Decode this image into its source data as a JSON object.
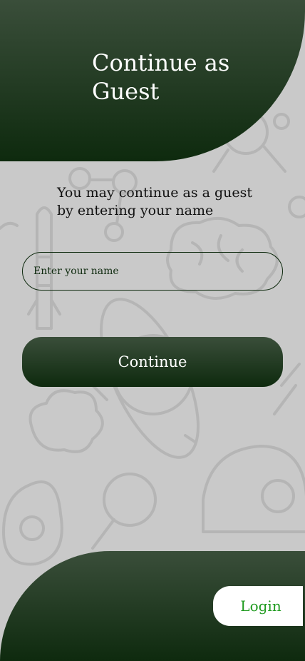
{
  "header": {
    "title": "Continue as Guest"
  },
  "intro": {
    "text": "You may continue as a guest by entering your name"
  },
  "guest_form": {
    "name_placeholder": "Enter your name",
    "name_value": "",
    "continue_label": "Continue"
  },
  "footer": {
    "login_label": "Login"
  },
  "colors": {
    "brand_dark_green": "#0e2a0e",
    "brand_mid_green": "#3a4e3a",
    "login_text_green": "#1e9a1e",
    "background_gray": "#c9c9c9"
  },
  "icons": [
    "science-doodle-pattern"
  ]
}
